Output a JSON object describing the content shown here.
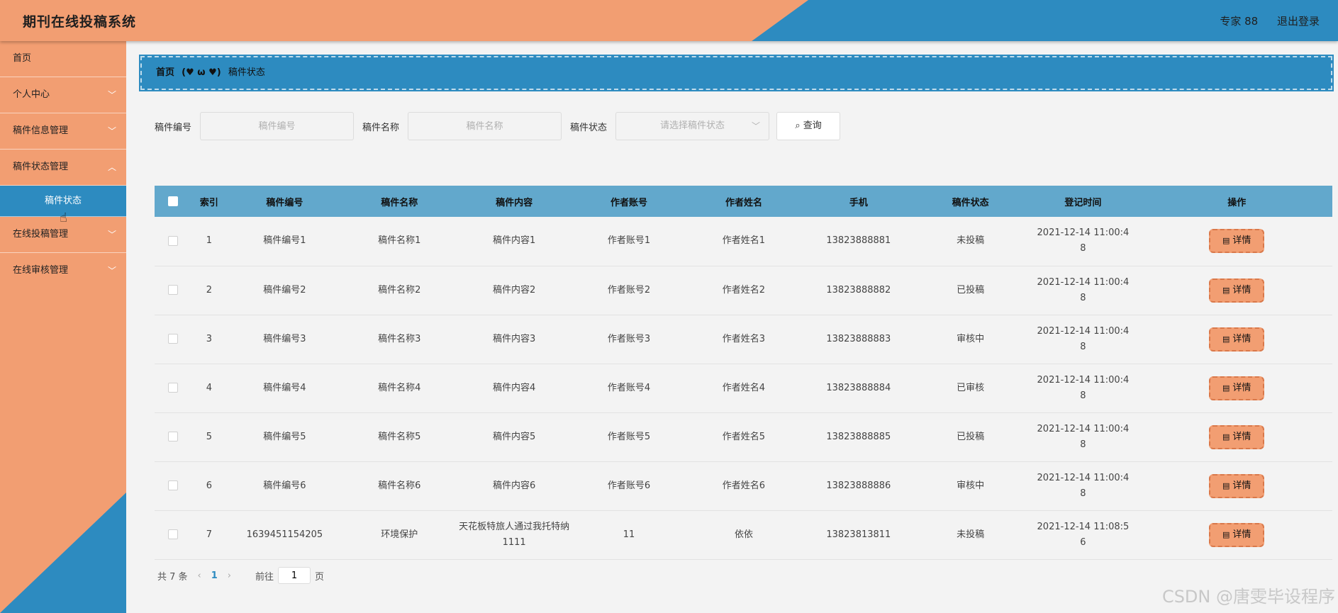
{
  "header": {
    "title": "期刊在线投稿系统",
    "user": "专家 88",
    "logout": "退出登录"
  },
  "sidebar": {
    "items": [
      {
        "label": "首页",
        "has_chevron": false
      },
      {
        "label": "个人中心",
        "has_chevron": true
      },
      {
        "label": "稿件信息管理",
        "has_chevron": true
      },
      {
        "label": "稿件状态管理",
        "has_chevron": true
      }
    ],
    "active_sub": "稿件状态",
    "items_after": [
      {
        "label": "在线投稿管理",
        "has_chevron": true
      },
      {
        "label": "在线审核管理",
        "has_chevron": true
      }
    ]
  },
  "breadcrumb": {
    "home": "首页",
    "separator": "(♥ ω ♥)",
    "current": "稿件状态"
  },
  "search": {
    "code_label": "稿件编号",
    "code_placeholder": "稿件编号",
    "name_label": "稿件名称",
    "name_placeholder": "稿件名称",
    "status_label": "稿件状态",
    "status_placeholder": "请选择稿件状态",
    "query_button": "查询"
  },
  "table": {
    "headers": [
      "索引",
      "稿件编号",
      "稿件名称",
      "稿件内容",
      "作者账号",
      "作者姓名",
      "手机",
      "稿件状态",
      "登记时间",
      "操作"
    ],
    "detail_label": "详情",
    "rows": [
      {
        "index": "1",
        "code": "稿件编号1",
        "name": "稿件名称1",
        "content": "稿件内容1",
        "account": "作者账号1",
        "author": "作者姓名1",
        "phone": "13823888881",
        "status": "未投稿",
        "time_l1": "2021-12-14 11:00:4",
        "time_l2": "8"
      },
      {
        "index": "2",
        "code": "稿件编号2",
        "name": "稿件名称2",
        "content": "稿件内容2",
        "account": "作者账号2",
        "author": "作者姓名2",
        "phone": "13823888882",
        "status": "已投稿",
        "time_l1": "2021-12-14 11:00:4",
        "time_l2": "8"
      },
      {
        "index": "3",
        "code": "稿件编号3",
        "name": "稿件名称3",
        "content": "稿件内容3",
        "account": "作者账号3",
        "author": "作者姓名3",
        "phone": "13823888883",
        "status": "审核中",
        "time_l1": "2021-12-14 11:00:4",
        "time_l2": "8"
      },
      {
        "index": "4",
        "code": "稿件编号4",
        "name": "稿件名称4",
        "content": "稿件内容4",
        "account": "作者账号4",
        "author": "作者姓名4",
        "phone": "13823888884",
        "status": "已审核",
        "time_l1": "2021-12-14 11:00:4",
        "time_l2": "8"
      },
      {
        "index": "5",
        "code": "稿件编号5",
        "name": "稿件名称5",
        "content": "稿件内容5",
        "account": "作者账号5",
        "author": "作者姓名5",
        "phone": "13823888885",
        "status": "已投稿",
        "time_l1": "2021-12-14 11:00:4",
        "time_l2": "8"
      },
      {
        "index": "6",
        "code": "稿件编号6",
        "name": "稿件名称6",
        "content": "稿件内容6",
        "account": "作者账号6",
        "author": "作者姓名6",
        "phone": "13823888886",
        "status": "审核中",
        "time_l1": "2021-12-14 11:00:4",
        "time_l2": "8"
      },
      {
        "index": "7",
        "code": "1639451154205",
        "name": "环境保护",
        "content": "天花板特旅人通过我托特纳1111",
        "account": "11",
        "author": "依依",
        "phone": "13823813811",
        "status": "未投稿",
        "time_l1": "2021-12-14 11:08:5",
        "time_l2": "6"
      }
    ]
  },
  "pagination": {
    "total": "共 7 条",
    "prev": "‹",
    "current_page": "1",
    "next": "›",
    "goto_label": "前往",
    "goto_value": "1",
    "page_suffix": "页"
  },
  "watermark": "CSDN @唐雯毕设程序",
  "colors": {
    "orange": "#f29e72",
    "blue": "#2d8bc0",
    "table_header": "#62a8cc"
  }
}
